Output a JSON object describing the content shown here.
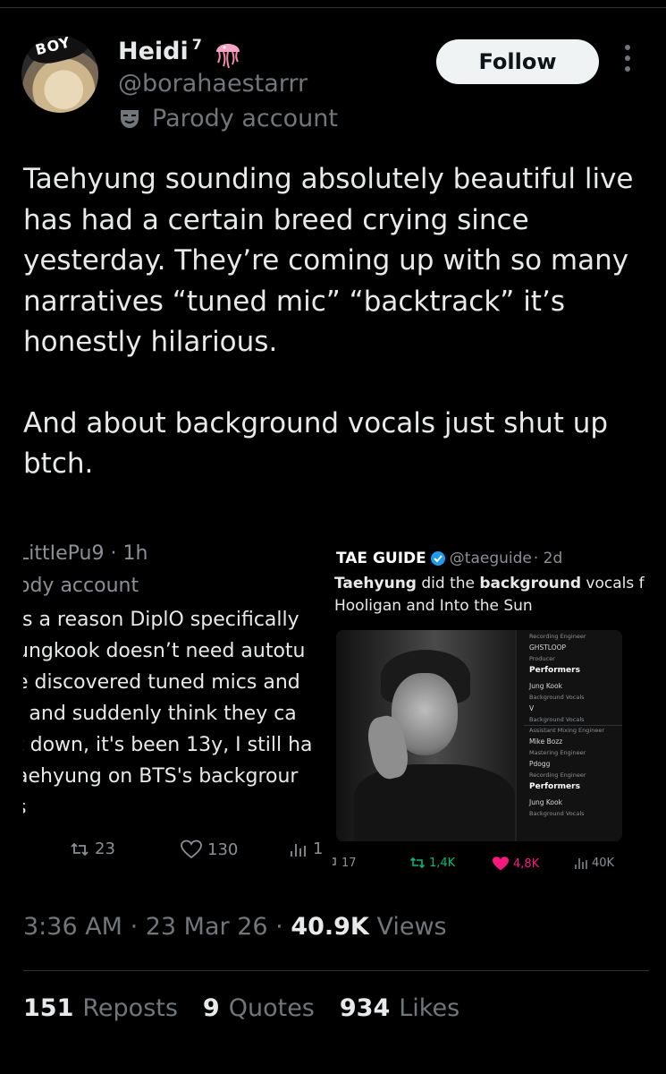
{
  "author": {
    "name": "Heidi",
    "name_suffix": "7",
    "emoji_icon": "jellyfish-icon",
    "handle": "@borahaestarrr",
    "label": "Parody account",
    "avatar_cap_text": "BOY"
  },
  "follow_label": "Follow",
  "tweet": {
    "paragraph1": "Taehyung sounding absolutely beautiful live has had a certain breed crying since yesterday. They’re coming up with so many narratives “tuned mic” “backtrack” it’s honestly hilarious.",
    "paragraph2": "And about background vocals just shut up btch."
  },
  "embedded_left": {
    "header": "LittIePu9 · 1h",
    "subheader": "ody account",
    "lines": [
      "’s a reason DiplO specifically",
      "ungkook doesn’t need autotu",
      "e discovered tuned mics and",
      "; and suddenly think they ca",
      "t down, it's been 13y, I still ha",
      "aehyung on BTS's backgrour",
      "s"
    ],
    "retweets": "23",
    "likes": "130",
    "views": "1"
  },
  "embedded_right": {
    "name": "TAE GUIDE",
    "handle": "@taeguide",
    "time": "· 2d",
    "text_line1_pre": "Taehyung",
    "text_line1_mid": " did the ",
    "text_line1_bold": "background",
    "text_line1_post": " vocals f",
    "text_line2": "Hooligan and Into the Sun",
    "credits": [
      {
        "kind": "role",
        "text": "Recording Engineer"
      },
      {
        "kind": "name",
        "text": "GHSTLOOP"
      },
      {
        "kind": "role",
        "text": "Producer"
      },
      {
        "kind": "head",
        "text": "Performers"
      },
      {
        "kind": "name",
        "text": "Jung Kook"
      },
      {
        "kind": "role",
        "text": "Background Vocals"
      },
      {
        "kind": "name",
        "text": "V"
      },
      {
        "kind": "role",
        "text": "Background Vocals"
      },
      {
        "kind": "role",
        "text": "Assistant Mixing Engineer"
      },
      {
        "kind": "name",
        "text": "Mike Bozz"
      },
      {
        "kind": "role",
        "text": "Mastering Engineer"
      },
      {
        "kind": "name",
        "text": "Pdogg"
      },
      {
        "kind": "role",
        "text": "Recording Engineer"
      },
      {
        "kind": "head",
        "text": "Performers"
      },
      {
        "kind": "name",
        "text": "Jung Kook"
      },
      {
        "kind": "role",
        "text": "Background Vocals"
      }
    ],
    "replies": "17",
    "retweets": "1,4K",
    "likes": "4,8K",
    "views": "40K"
  },
  "meta": {
    "time": "3:36 AM",
    "date": "23 Mar 26",
    "views_count": "40.9K",
    "views_label": "Views"
  },
  "counts": {
    "reposts": "151",
    "reposts_label": "Reposts",
    "quotes": "9",
    "quotes_label": "Quotes",
    "likes": "934",
    "likes_label": "Likes"
  },
  "colors": {
    "background": "#000000",
    "text": "#e7e9ea",
    "muted": "#71767b",
    "retweet_green": "#00ba7c",
    "like_pink": "#f91880",
    "verified_blue": "#1d9bf0"
  }
}
